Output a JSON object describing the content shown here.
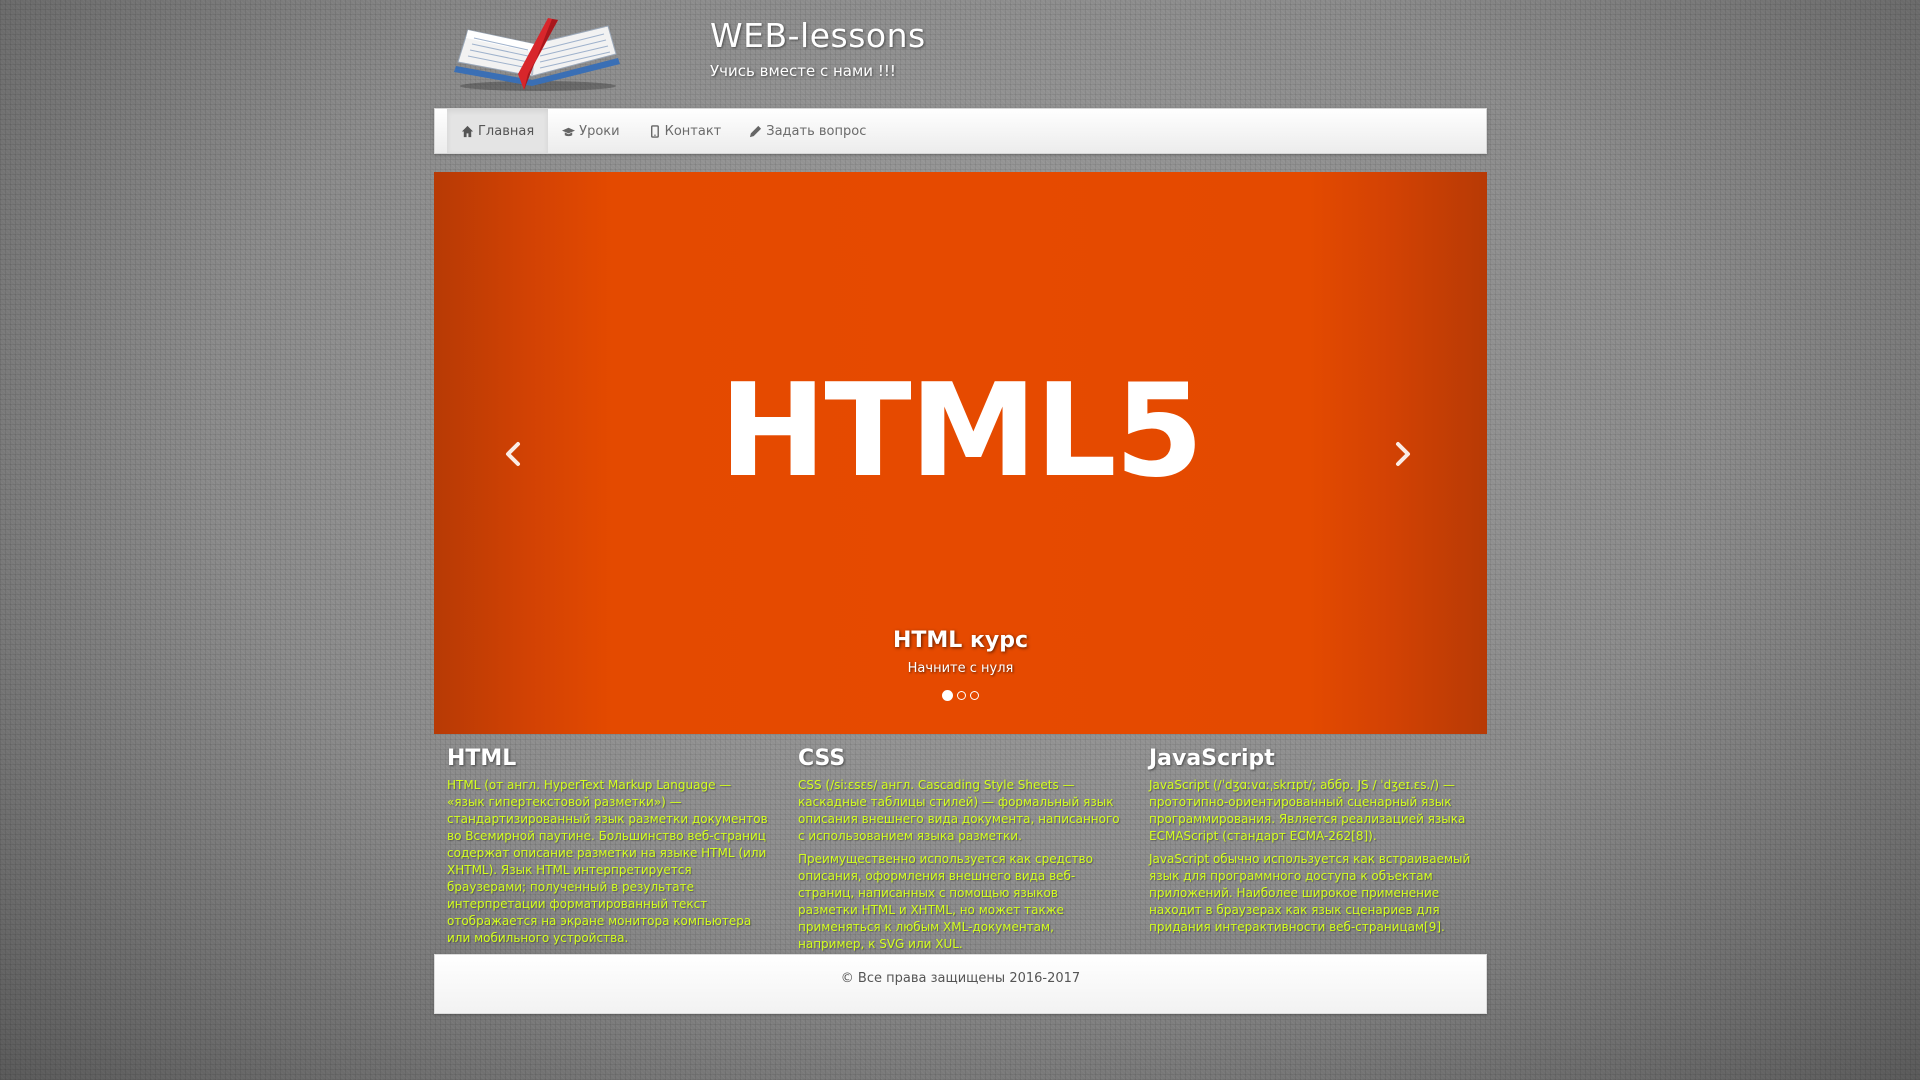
{
  "header": {
    "title": "WEB-lessons",
    "tagline": "Учись вместе с нами !!!"
  },
  "nav": {
    "items": [
      {
        "label": "Главная",
        "icon": "home-icon",
        "active": true
      },
      {
        "label": "Уроки",
        "icon": "graduation-cap-icon",
        "active": false
      },
      {
        "label": "Контакт",
        "icon": "phone-icon",
        "active": false
      },
      {
        "label": "Задать вопрос",
        "icon": "pencil-icon",
        "active": false
      }
    ]
  },
  "carousel": {
    "slide_image_text": "HTML5",
    "caption_title": "HTML курс",
    "caption_text": "Начните с нуля",
    "slide_count": 3,
    "active_index": 0,
    "background_color": "#e64a00"
  },
  "columns": [
    {
      "title": "HTML",
      "paragraphs": [
        "HTML (от англ. HyperText Markup Language — «язык гипертекстовой разметки») — стандартизированный язык разметки документов во Всемирной паутине. Большинство веб-страниц содержат описание разметки на языке HTML (или XHTML). Язык HTML интерпретируется браузерами; полученный в результате интерпретации форматированный текст отображается на экране монитора компьютера или мобильного устройства."
      ]
    },
    {
      "title": "CSS",
      "paragraphs": [
        "CSS (/siːɛsɛs/ англ. Cascading Style Sheets — каскадные таблицы стилей) — формальный язык описания внешнего вида документа, написанного с использованием языка разметки.",
        "Преимущественно используется как средство описания, оформления внешнего вида веб-страниц, написанных с помощью языков разметки HTML и XHTML, но может также применяться к любым XML-документам, например, к SVG или XUL."
      ]
    },
    {
      "title": "JavaScript",
      "paragraphs": [
        "JavaScript (/ˈdʒɑːvɑːˌskrɪpt/; аббр. JS / ˈdʒeɪ.ɛs./) — прототипно-ориентированный сценарный язык программирования. Является реализацией языка ECMAScript (стандарт ECMA-262[8]).",
        "JavaScript обычно используется как встраиваемый язык для программного доступа к объектам приложений. Наиболее широкое применение находит в браузерах как язык сценариев для придания интерактивности веб-страницам[9]."
      ]
    }
  ],
  "footer": {
    "text": "© Все права защищены 2016-2017"
  },
  "colors": {
    "accent_text": "#d4ff1e",
    "slide_orange": "#e64a00"
  }
}
